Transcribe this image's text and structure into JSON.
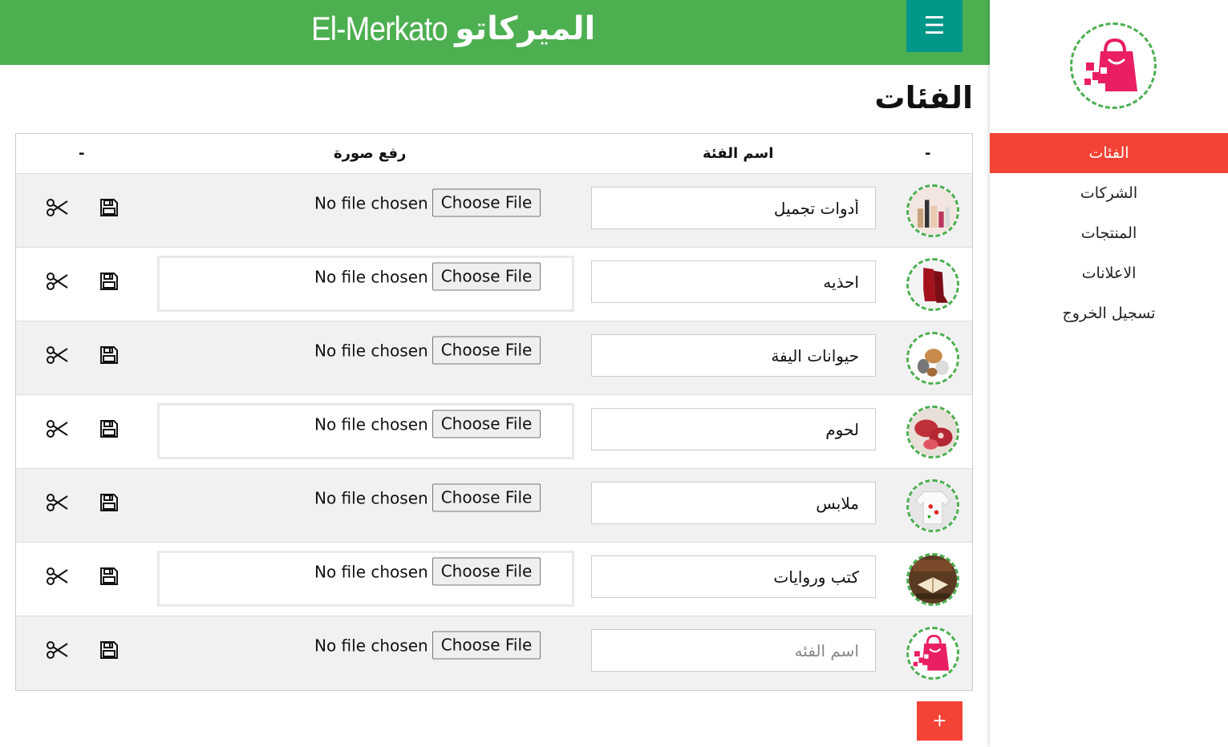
{
  "header": {
    "brand_latin": "El-Merkato",
    "brand_arabic": "الميركاتو",
    "menu_icon": "☰"
  },
  "sidebar": {
    "items": [
      {
        "label": "الفئات",
        "active": true
      },
      {
        "label": "الشركات",
        "active": false
      },
      {
        "label": "المنتجات",
        "active": false
      },
      {
        "label": "الاعلانات",
        "active": false
      },
      {
        "label": "تسجيل الخروج",
        "active": false
      }
    ]
  },
  "page": {
    "title": "الفئات"
  },
  "table": {
    "headers": {
      "image": "-",
      "name": "اسم الفئة",
      "upload": "رفع صورة",
      "actions": "-"
    },
    "file_button_label": "Choose File",
    "file_status": "No file chosen",
    "rows": [
      {
        "name": "أدوات تجميل",
        "thumb": "cosmetics"
      },
      {
        "name": "احذيه",
        "thumb": "shoes"
      },
      {
        "name": "حيوانات اليفة",
        "thumb": "pets"
      },
      {
        "name": "لحوم",
        "thumb": "meat"
      },
      {
        "name": "ملابس",
        "thumb": "clothes"
      },
      {
        "name": "كتب وروايات",
        "thumb": "books"
      },
      {
        "name": "",
        "placeholder": "اسم الفئه",
        "thumb": "logo"
      }
    ]
  },
  "add_button": "+",
  "colors": {
    "header": "#4caf50",
    "menu": "#009688",
    "accent": "#f44336",
    "brand_pink": "#e91e63"
  }
}
